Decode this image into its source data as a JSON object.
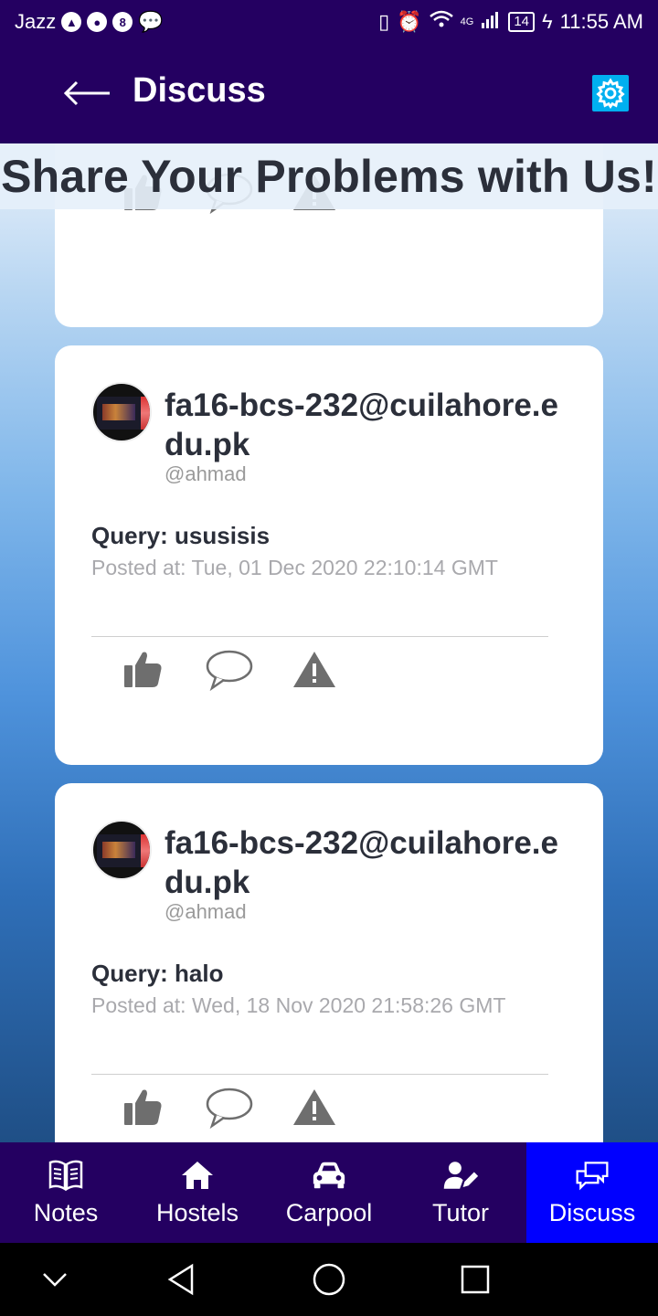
{
  "status_bar": {
    "carrier": "Jazz",
    "signal": "4G",
    "battery": "14",
    "time": "11:55 AM"
  },
  "app_bar": {
    "title": "Discuss"
  },
  "banner": {
    "text": "Share Your Problems with Us!"
  },
  "posts": [
    {
      "email": "fa16-bcs-232@cuilahore.edu.pk",
      "handle": "@ahmad",
      "query": "Query: ususisis",
      "posted": "Posted at: Tue, 01 Dec 2020 22:10:14 GMT"
    },
    {
      "email": "fa16-bcs-232@cuilahore.edu.pk",
      "handle": "@ahmad",
      "query": "Query: halo",
      "posted": "Posted at: Wed, 18 Nov 2020 21:58:26 GMT"
    }
  ],
  "bottom_nav": [
    {
      "label": "Notes",
      "icon": "book-icon"
    },
    {
      "label": "Hostels",
      "icon": "home-icon"
    },
    {
      "label": "Carpool",
      "icon": "car-icon"
    },
    {
      "label": "Tutor",
      "icon": "tutor-icon"
    },
    {
      "label": "Discuss",
      "icon": "chat-icon"
    }
  ],
  "colors": {
    "primary": "#240061",
    "active_tab": "#0000ff",
    "settings_bg": "#00b0f0",
    "icon_gray": "#6e6e6e"
  }
}
